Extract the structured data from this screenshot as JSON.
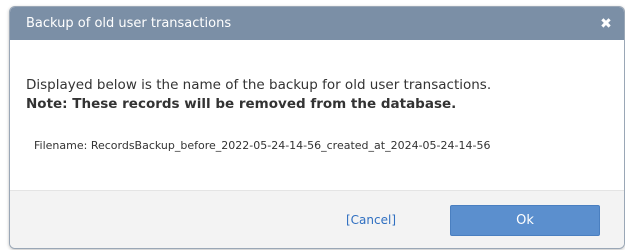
{
  "dialog": {
    "title": "Backup of old user transactions",
    "close_icon": "close-icon",
    "message": "Displayed below is the name of the backup for old user transactions.",
    "note": "Note: These records will be removed from the database.",
    "filename_label": "Filename:",
    "filename_value": "RecordsBackup_before_2022-05-24-14-56_created_at_2024-05-24-14-56",
    "cancel_label": "[Cancel]",
    "ok_label": "Ok"
  },
  "colors": {
    "titlebar": "#7b8fa6",
    "ok_button": "#5b8fce",
    "cancel_link": "#2f6fc1",
    "footer": "#f3f3f3"
  }
}
